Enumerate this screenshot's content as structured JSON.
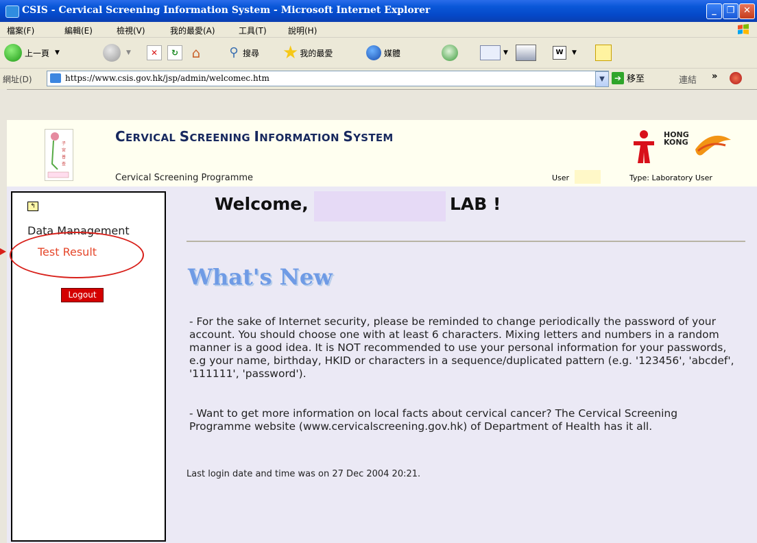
{
  "window": {
    "title": "CSIS - Cervical Screening Information System - Microsoft Internet Explorer",
    "controls": [
      "_",
      "❐",
      "✕"
    ]
  },
  "menubar": {
    "items": [
      "檔案(F)",
      "編輯(E)",
      "檢視(V)",
      "我的最愛(A)",
      "工具(T)",
      "說明(H)"
    ]
  },
  "toolbar": {
    "back_label": "上一頁",
    "search_label": "搜尋",
    "favorites_label": "我的最愛",
    "media_label": "媒體"
  },
  "address_bar": {
    "label": "網址(D)",
    "url": "https://www.csis.gov.hk/jsp/admin/welcomec.htm",
    "go_label": "移至",
    "links_label": "連結",
    "more": "»"
  },
  "header": {
    "title_c": "C",
    "title_1": "ERVICAL ",
    "title_s": "S",
    "title_2": "CREENING ",
    "title_i": "I",
    "title_3": "NFORMATION ",
    "title_s2": "S",
    "title_4": "YSTEM",
    "programme": "Cervical Screening Programme",
    "user_label": "User",
    "type_label": "Type: Laboratory User",
    "hk_logo_text_1": "HONG",
    "hk_logo_text_2": "KONG"
  },
  "sidebar": {
    "section": "Data Management",
    "item": "Test Result",
    "logout_label": "Logout"
  },
  "main": {
    "welcome_prefix": "Welcome,",
    "welcome_suffix": "LAB !",
    "heading": "What's New",
    "para1": "- For the sake of Internet security, please be reminded to change periodically the password of your account. You should choose one with at least 6 characters. Mixing letters and numbers in a random manner is a good idea. It is NOT recommended to use your personal information for your passwords, e.g your name, birthday, HKID or characters in a sequence/duplicated pattern (e.g. '123456', 'abcdef', '111111', 'password').",
    "para2": "- Want to get more information on local facts about cervical cancer? The Cervical Screening Programme website (www.cervicalscreening.gov.hk) of Department of Health has it all.",
    "last_login": "Last login date and time was on 27 Dec 2004 20:21."
  },
  "colors": {
    "title_blue": "#17285e",
    "heading_blue": "#6f9be5",
    "test_result": "#e5462a",
    "logout_bg": "#d40000",
    "annotation_red": "#d8201a"
  }
}
